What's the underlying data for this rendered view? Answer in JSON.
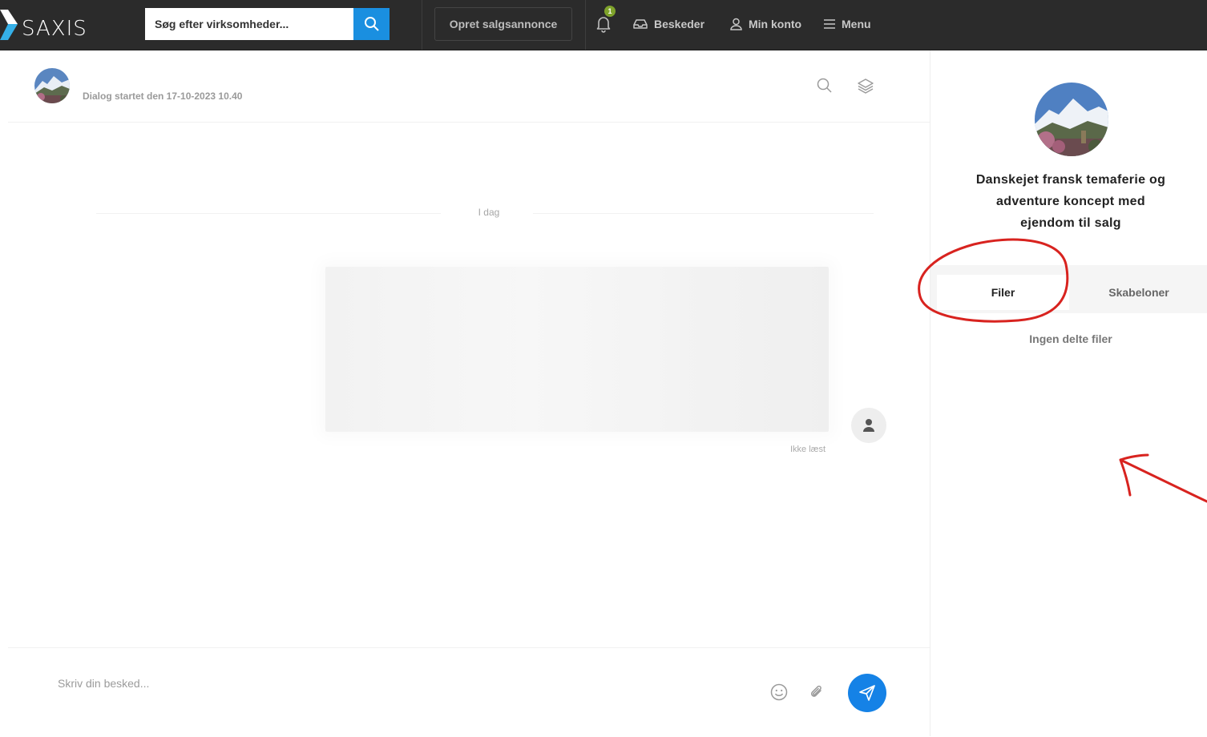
{
  "topbar": {
    "logo_text": "SAXIS",
    "search_placeholder": "Søg efter virksomheder...",
    "create_ad_label": "Opret salgsannonce",
    "notification_count": "1",
    "nav": {
      "messages": "Beskeder",
      "account": "Min konto",
      "menu": "Menu"
    }
  },
  "chat": {
    "dialog_started": "Dialog startet den 17-10-2023 10.40",
    "day_label": "I dag",
    "message_status": "Ikke læst",
    "composer_placeholder": "Skriv din besked..."
  },
  "side_panel": {
    "company_name": "Danskejet fransk temaferie og adventure koncept med ejendom til salg",
    "tabs": {
      "files": "Filer",
      "templates": "Skabeloner"
    },
    "empty_files_text": "Ingen delte filer"
  },
  "colors": {
    "topbar_bg": "#2b2b2b",
    "accent_blue": "#1582e6",
    "badge_green": "#7fa32b",
    "annotation_red": "#d8231f"
  }
}
